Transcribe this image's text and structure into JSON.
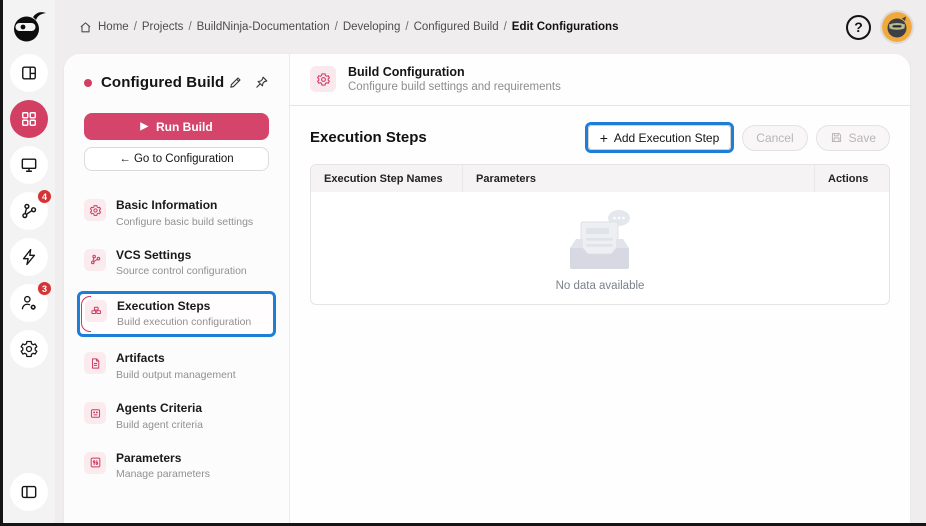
{
  "topbar": {
    "separator": "/",
    "breadcrumb": [
      {
        "label": "Home"
      },
      {
        "label": "Projects"
      },
      {
        "label": "BuildNinja-Documentation"
      },
      {
        "label": "Developing"
      },
      {
        "label": "Configured Build"
      },
      {
        "label": "Edit Configurations"
      }
    ],
    "help_glyph": "?"
  },
  "sidebar": {
    "badges": {
      "pipelines": "4",
      "agents": "3"
    }
  },
  "left_panel": {
    "title": "Configured Build",
    "run_button": {
      "icon": "play",
      "label": "Run Build"
    },
    "goto_button": "← Go to Configuration",
    "menu": [
      {
        "title": "Basic Information",
        "subtitle": "Configure basic build settings"
      },
      {
        "title": "VCS Settings",
        "subtitle": "Source control configuration"
      },
      {
        "title": "Execution Steps",
        "subtitle": "Build execution configuration"
      },
      {
        "title": "Artifacts",
        "subtitle": "Build output management"
      },
      {
        "title": "Agents Criteria",
        "subtitle": "Build agent criteria"
      },
      {
        "title": "Parameters",
        "subtitle": "Manage parameters"
      }
    ]
  },
  "main": {
    "header": {
      "title": "Build Configuration",
      "subtitle": "Configure build settings and requirements"
    },
    "section_title": "Execution Steps",
    "buttons": {
      "add": "Add Execution Step",
      "cancel": "Cancel",
      "save": "Save"
    },
    "table": {
      "columns": [
        "Execution Step Names",
        "Parameters",
        "Actions"
      ],
      "empty_text": "No data available"
    }
  },
  "colors": {
    "accent_crimson": "#d23f63",
    "highlight_blue": "#1e7ed7",
    "badge_red": "#d63434",
    "avatar_bg": "#f0a93a"
  }
}
